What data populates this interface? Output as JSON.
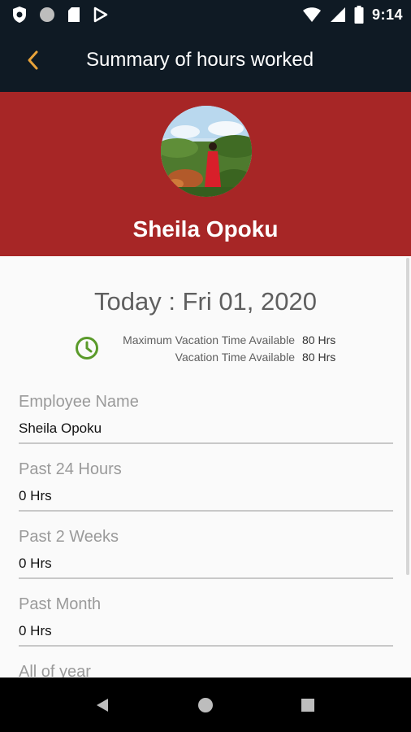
{
  "status_bar": {
    "time": "9:14",
    "left_icons": [
      "shield-icon",
      "circle-icon",
      "sd-card-icon",
      "play-store-icon"
    ],
    "right_icons": [
      "wifi-icon",
      "signal-icon",
      "battery-icon"
    ]
  },
  "app_bar": {
    "title": "Summary of hours worked",
    "back_icon": "chevron-left-icon",
    "accent_color": "#e8a33a",
    "background_color": "#0f1a24"
  },
  "profile": {
    "name": "Sheila Opoku",
    "band_color": "#a72626"
  },
  "summary": {
    "today": "Today : Fri 01, 2020",
    "clock_color": "#5a9a2a",
    "vacation": [
      {
        "label": "Maximum Vacation Time Available",
        "value": "80 Hrs"
      },
      {
        "label": "Vacation Time Available",
        "value": "80 Hrs"
      }
    ]
  },
  "fields": [
    {
      "label": "Employee Name",
      "value": "Sheila Opoku"
    },
    {
      "label": "Past 24 Hours",
      "value": "0 Hrs"
    },
    {
      "label": "Past 2 Weeks",
      "value": "0 Hrs"
    },
    {
      "label": "Past Month",
      "value": "0 Hrs"
    },
    {
      "label": "All of year",
      "value": ""
    }
  ],
  "nav_bar": {
    "icons": [
      "back-triangle-icon",
      "home-circle-icon",
      "recents-square-icon"
    ]
  }
}
